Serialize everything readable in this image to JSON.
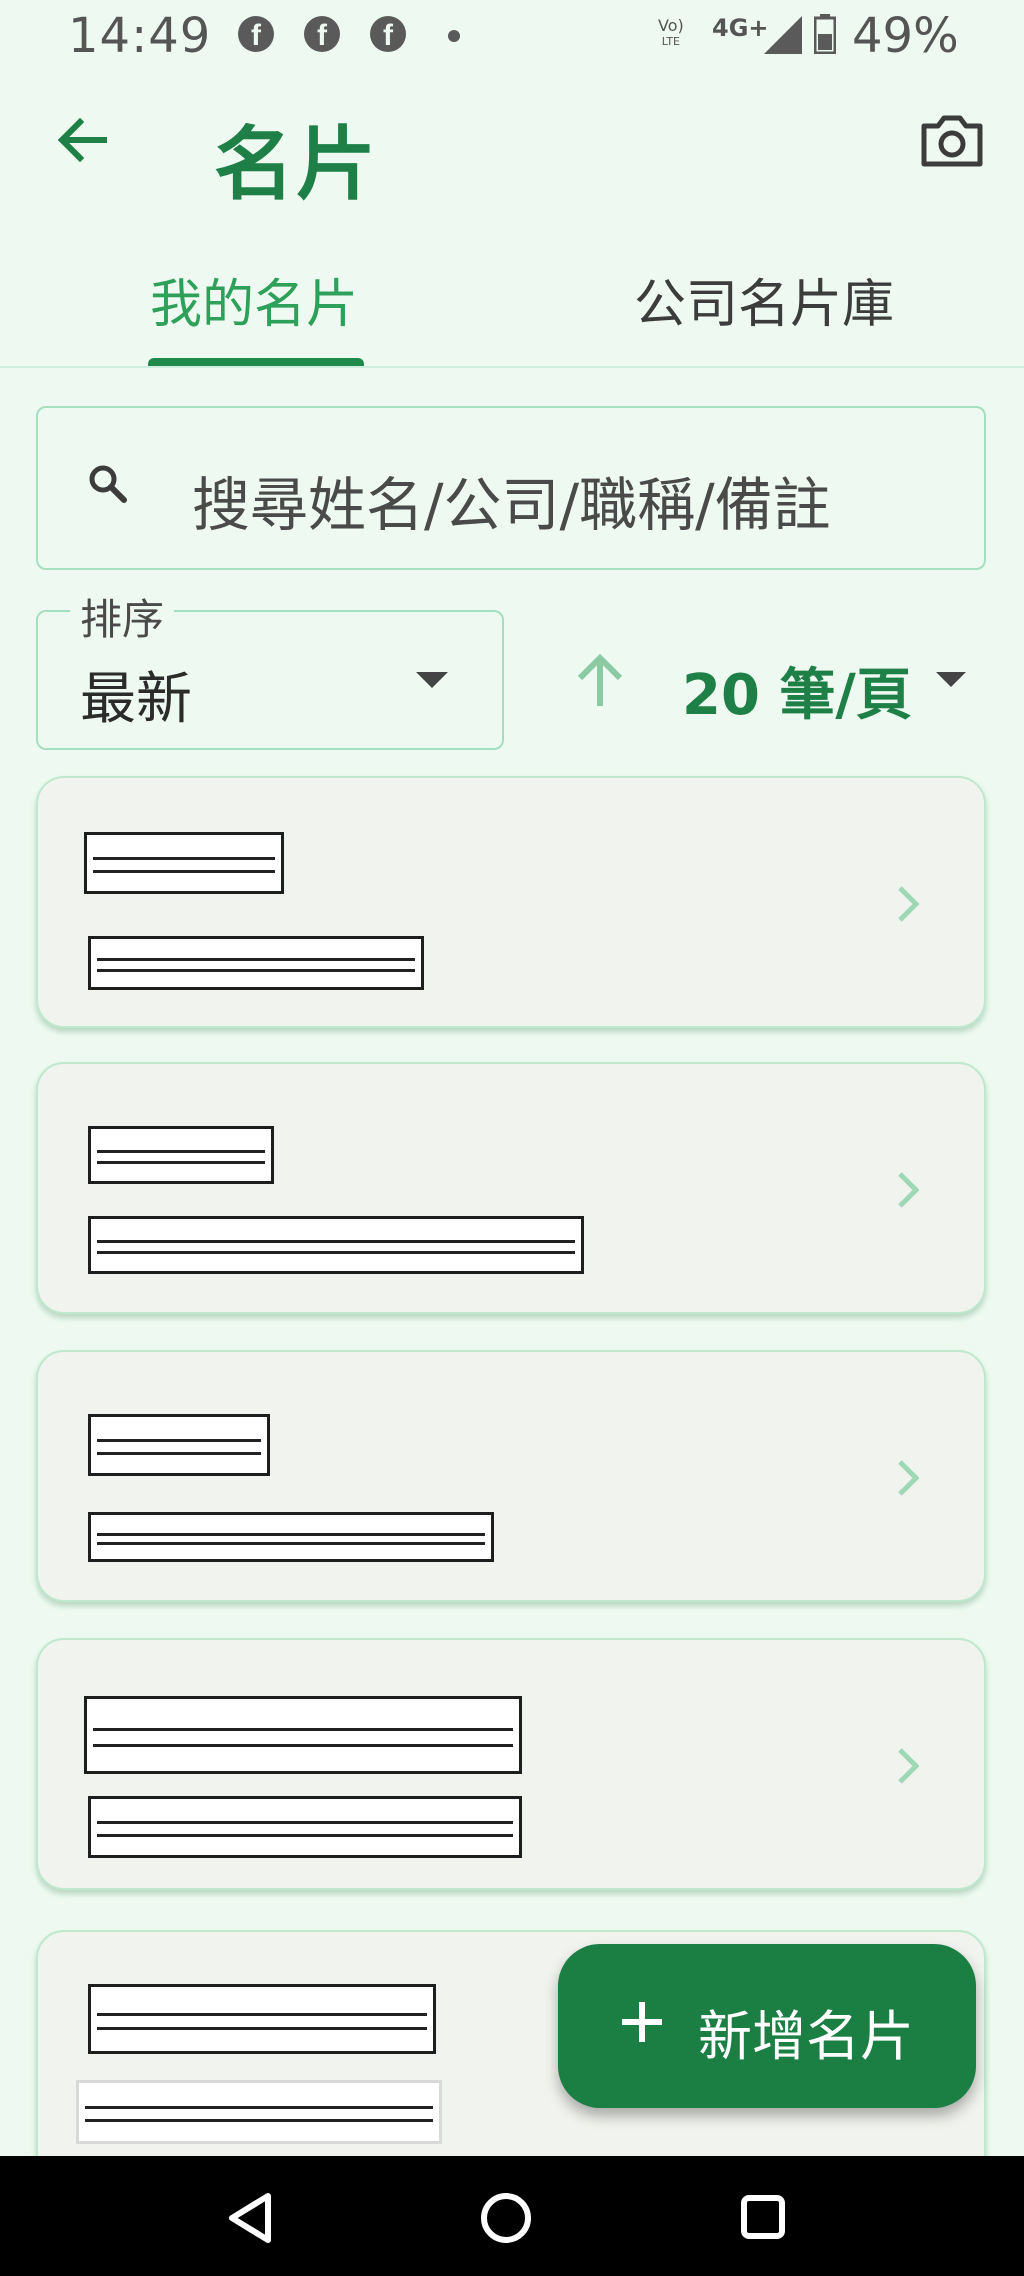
{
  "status_bar": {
    "time": "14:49",
    "notification_icons": [
      "facebook-icon",
      "facebook-icon",
      "facebook-icon",
      "dot-icon"
    ],
    "volte": "Vo)",
    "volte_sub": "LTE",
    "network": "4G+",
    "battery": "49%"
  },
  "app_bar": {
    "title": "名片",
    "back_icon": "arrow-left-icon",
    "camera_icon": "camera-icon"
  },
  "tabs": [
    {
      "label": "我的名片",
      "active": true
    },
    {
      "label": "公司名片庫",
      "active": false
    }
  ],
  "search": {
    "placeholder": "搜尋姓名/公司/職稱/備註"
  },
  "sort": {
    "label": "排序",
    "value": "最新",
    "order_icon": "arrow-up-icon",
    "per_page": "20 筆/頁"
  },
  "cards": [
    {
      "name": "[redacted]",
      "company": "[redacted]"
    },
    {
      "name": "[redacted]",
      "company": "[redacted]"
    },
    {
      "name": "[redacted]",
      "company": "[redacted]"
    },
    {
      "name": "[redacted]",
      "company": "[redacted]"
    },
    {
      "name": "[redacted]",
      "company": "[redacted]"
    }
  ],
  "fab": {
    "label": "新增名片",
    "icon": "plus-icon"
  },
  "colors": {
    "background": "#eefaf1",
    "primary": "#1e7f47",
    "tab_active": "#2ea05a",
    "card": "#f1f3ee",
    "border": "#a6dfbf"
  }
}
